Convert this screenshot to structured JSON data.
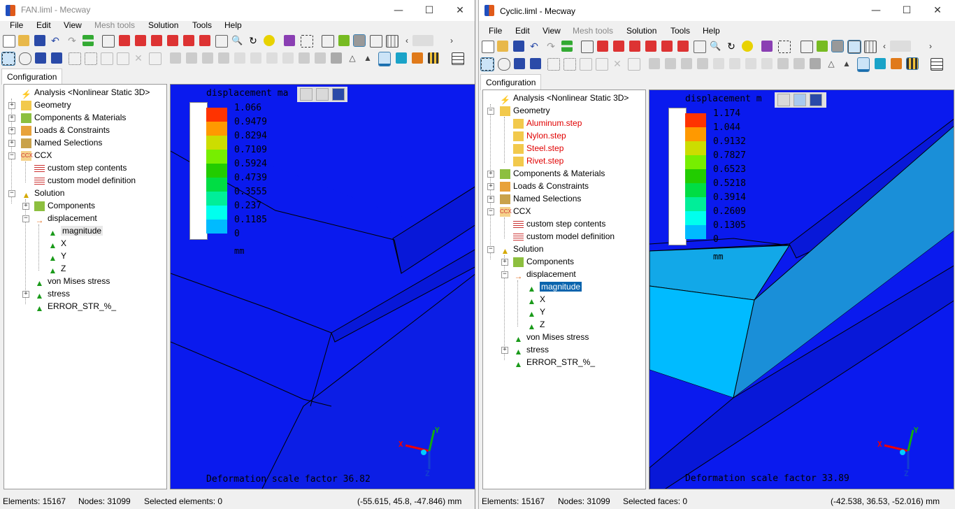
{
  "left": {
    "title": "FAN.liml - Mecway",
    "menu": [
      "File",
      "Edit",
      "View",
      "Mesh tools",
      "Solution",
      "Tools",
      "Help"
    ],
    "tab": "Configuration",
    "tree": {
      "analysis": "Analysis <Nonlinear Static 3D>",
      "geometry": "Geometry",
      "components_materials": "Components & Materials",
      "loads": "Loads & Constraints",
      "named": "Named Selections",
      "ccx": "CCX",
      "custom_step": "custom step contents",
      "custom_model": "custom model definition",
      "solution": "Solution",
      "components": "Components",
      "displacement": "displacement",
      "magnitude": "magnitude",
      "x": "X",
      "y": "Y",
      "z": "Z",
      "vonmises": "von Mises stress",
      "stress": "stress",
      "error": "ERROR_STR_%_"
    },
    "viewport_title": "displacement ma",
    "legend": [
      "1.066",
      "0.9479",
      "0.8294",
      "0.7109",
      "0.5924",
      "0.4739",
      "0.3555",
      "0.237",
      "0.1185",
      "0"
    ],
    "legend_colors": [
      "#ff3300",
      "#ff9900",
      "#ccdd00",
      "#77ee00",
      "#22cc00",
      "#00dd44",
      "#00ee99",
      "#00ffee",
      "#00bbff",
      "#0a1aee"
    ],
    "unit": "mm",
    "scale": "Deformation scale factor 36.82",
    "status": {
      "elements": "Elements: 15167",
      "nodes": "Nodes: 31099",
      "selected": "Selected elements: 0",
      "coords": "(-55.615, 45.8, -47.846) mm"
    },
    "axis": {
      "x": "X",
      "y": "Y",
      "z": "Z"
    }
  },
  "right": {
    "title": "Cyclic.liml - Mecway",
    "menu": [
      "File",
      "Edit",
      "View",
      "Mesh tools",
      "Solution",
      "Tools",
      "Help"
    ],
    "tab": "Configuration",
    "tree": {
      "analysis": "Analysis <Nonlinear Static 3D>",
      "geometry": "Geometry",
      "aluminum": "Aluminum.step",
      "nylon": "Nylon.step",
      "steel": "Steel.step",
      "rivet": "Rivet.step",
      "components_materials": "Components & Materials",
      "loads": "Loads & Constraints",
      "named": "Named Selections",
      "ccx": "CCX",
      "custom_step": "custom step contents",
      "custom_model": "custom model definition",
      "solution": "Solution",
      "components": "Components",
      "displacement": "displacement",
      "magnitude": "magnitude",
      "x": "X",
      "y": "Y",
      "z": "Z",
      "vonmises": "von Mises stress",
      "stress": "stress",
      "error": "ERROR_STR_%_"
    },
    "viewport_title": "displacement m",
    "legend": [
      "1.174",
      "1.044",
      "0.9132",
      "0.7827",
      "0.6523",
      "0.5218",
      "0.3914",
      "0.2609",
      "0.1305",
      "0"
    ],
    "legend_colors": [
      "#ff3300",
      "#ff9900",
      "#ccdd00",
      "#77ee00",
      "#22cc00",
      "#00dd44",
      "#00ee99",
      "#00ffee",
      "#00bbff",
      "#0a1aee"
    ],
    "unit": "mm",
    "scale": "Deformation scale factor 33.89",
    "status": {
      "elements": "Elements: 15167",
      "nodes": "Nodes: 31099",
      "selected": "Selected faces: 0",
      "coords": "(-42.538, 36.53, -52.016) mm"
    },
    "axis": {
      "x": "X",
      "y": "Y",
      "z": "Z"
    }
  },
  "window_controls": {
    "minimize": "—",
    "maximize": "☐",
    "close": "✕"
  }
}
